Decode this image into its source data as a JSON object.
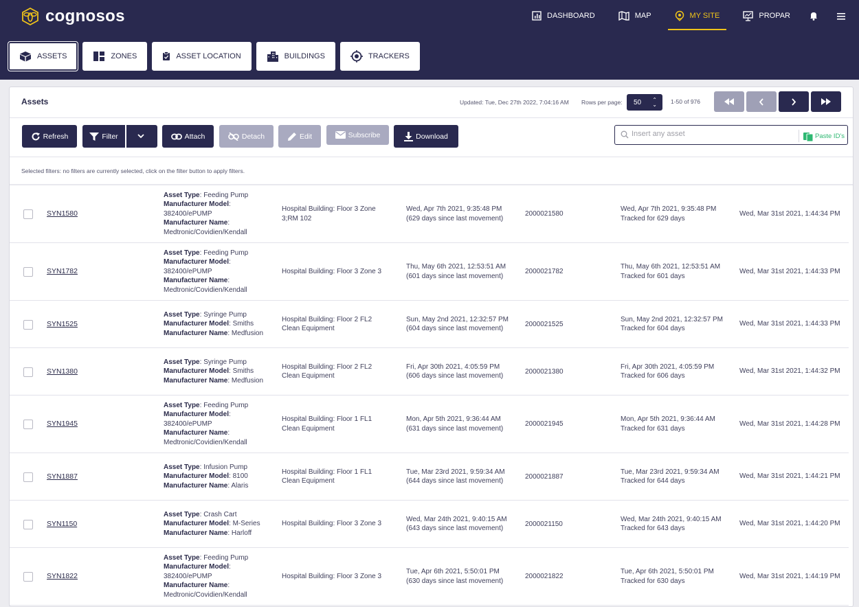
{
  "app": {
    "brand": "cognosos",
    "brand_color": "#29294f",
    "accent_color": "#f0c419"
  },
  "topnav": [
    {
      "label": "DASHBOARD",
      "icon": "chart-icon",
      "active": false
    },
    {
      "label": "MAP",
      "icon": "map-icon",
      "active": false
    },
    {
      "label": "MY SITE",
      "icon": "location-pin-icon",
      "active": true
    },
    {
      "label": "PROPAR",
      "icon": "presentation-icon",
      "active": false
    }
  ],
  "subtabs": [
    {
      "label": "ASSETS",
      "icon": "cube-icon",
      "active": true
    },
    {
      "label": "ZONES",
      "icon": "zones-icon",
      "active": false
    },
    {
      "label": "ASSET LOCATION",
      "icon": "clipboard-icon",
      "active": false
    },
    {
      "label": "BUILDINGS",
      "icon": "building-icon",
      "active": false
    },
    {
      "label": "TRACKERS",
      "icon": "target-icon",
      "active": false
    }
  ],
  "panel": {
    "title": "Assets",
    "updated": "Updated: Tue, Dec 27th 2022, 7:04:16 AM",
    "rows_per_page_label": "Rows per page:",
    "rows_per_page_value": "50",
    "range": "1-50 of 976"
  },
  "toolbar": {
    "refresh": "Refresh",
    "filter": "Filter",
    "attach": "Attach",
    "detach": "Detach",
    "edit": "Edit",
    "subscribe": "Subscribe",
    "download": "Download",
    "search_placeholder": "Insert any asset",
    "paste_ids": "Paste ID's"
  },
  "filters": {
    "label": "Selected filters:",
    "note": "no filters are currently selected, click on the filter button to apply filters."
  },
  "rows": [
    {
      "name": "SYN1580",
      "type": "Feeding Pump",
      "model": "382400/ePUMP",
      "manufacturer": "Medtronic/Covidien/Kendall",
      "location": "Hospital Building: Floor 3 Zone 3;RM 102",
      "last_moved": "Wed, Apr 7th 2021, 9:35:48 PM",
      "moved_days": "(629 days since last movement)",
      "tracker_id": "2000021580",
      "tracked_since": "Wed, Apr 7th 2021, 9:35:48 PM",
      "tracked_days": "Tracked for 629 days",
      "created": "Wed, Mar 31st 2021, 1:44:34 PM"
    },
    {
      "name": "SYN1782",
      "type": "Feeding Pump",
      "model": "382400/ePUMP",
      "manufacturer": "Medtronic/Covidien/Kendall",
      "location": "Hospital Building: Floor 3 Zone 3",
      "last_moved": "Thu, May 6th 2021, 12:53:51 AM",
      "moved_days": "(601 days since last movement)",
      "tracker_id": "2000021782",
      "tracked_since": "Thu, May 6th 2021, 12:53:51 AM",
      "tracked_days": "Tracked for 601 days",
      "created": "Wed, Mar 31st 2021, 1:44:33 PM"
    },
    {
      "name": "SYN1525",
      "type": "Syringe Pump",
      "model": "Smiths",
      "manufacturer": "Medfusion",
      "location": "Hospital Building: Floor 2 FL2 Clean Equipment",
      "last_moved": "Sun, May 2nd 2021, 12:32:57 PM",
      "moved_days": "(604 days since last movement)",
      "tracker_id": "2000021525",
      "tracked_since": "Sun, May 2nd 2021, 12:32:57 PM",
      "tracked_days": "Tracked for 604 days",
      "created": "Wed, Mar 31st 2021, 1:44:33 PM"
    },
    {
      "name": "SYN1380",
      "type": "Syringe Pump",
      "model": "Smiths",
      "manufacturer": "Medfusion",
      "location": "Hospital Building: Floor 2 FL2 Clean Equipment",
      "last_moved": "Fri, Apr 30th 2021, 4:05:59 PM",
      "moved_days": "(606 days since last movement)",
      "tracker_id": "2000021380",
      "tracked_since": "Fri, Apr 30th 2021, 4:05:59 PM",
      "tracked_days": "Tracked for 606 days",
      "created": "Wed, Mar 31st 2021, 1:44:32 PM"
    },
    {
      "name": "SYN1945",
      "type": "Feeding Pump",
      "model": "382400/ePUMP",
      "manufacturer": "Medtronic/Covidien/Kendall",
      "location": "Hospital Building: Floor 1 FL1 Clean Equipment",
      "last_moved": "Mon, Apr 5th 2021, 9:36:44 AM",
      "moved_days": "(631 days since last movement)",
      "tracker_id": "2000021945",
      "tracked_since": "Mon, Apr 5th 2021, 9:36:44 AM",
      "tracked_days": "Tracked for 631 days",
      "created": "Wed, Mar 31st 2021, 1:44:28 PM"
    },
    {
      "name": "SYN1887",
      "type": "Infusion Pump",
      "model": "8100",
      "manufacturer": "Alaris",
      "location": "Hospital Building: Floor 1 FL1 Clean Equipment",
      "last_moved": "Tue, Mar 23rd 2021, 9:59:34 AM",
      "moved_days": "(644 days since last movement)",
      "tracker_id": "2000021887",
      "tracked_since": "Tue, Mar 23rd 2021, 9:59:34 AM",
      "tracked_days": "Tracked for 644 days",
      "created": "Wed, Mar 31st 2021, 1:44:21 PM"
    },
    {
      "name": "SYN1150",
      "type": "Crash Cart",
      "model": "M-Series",
      "manufacturer": "Harloff",
      "location": "Hospital Building: Floor 3 Zone 3",
      "last_moved": "Wed, Mar 24th 2021, 9:40:15 AM",
      "moved_days": "(643 days since last movement)",
      "tracker_id": "2000021150",
      "tracked_since": "Wed, Mar 24th 2021, 9:40:15 AM",
      "tracked_days": "Tracked for 643 days",
      "created": "Wed, Mar 31st 2021, 1:44:20 PM"
    },
    {
      "name": "SYN1822",
      "type": "Feeding Pump",
      "model": "382400/ePUMP",
      "manufacturer": "Medtronic/Covidien/Kendall",
      "location": "Hospital Building: Floor 3 Zone 3",
      "last_moved": "Tue, Apr 6th 2021, 5:50:01 PM",
      "moved_days": "(630 days since last movement)",
      "tracker_id": "2000021822",
      "tracked_since": "Tue, Apr 6th 2021, 5:50:01 PM",
      "tracked_days": "Tracked for 630 days",
      "created": "Wed, Mar 31st 2021, 1:44:19 PM"
    }
  ],
  "labels": {
    "asset_type": "Asset Type",
    "manufacturer_model": "Manufacturer Model",
    "manufacturer_name": "Manufacturer Name"
  }
}
